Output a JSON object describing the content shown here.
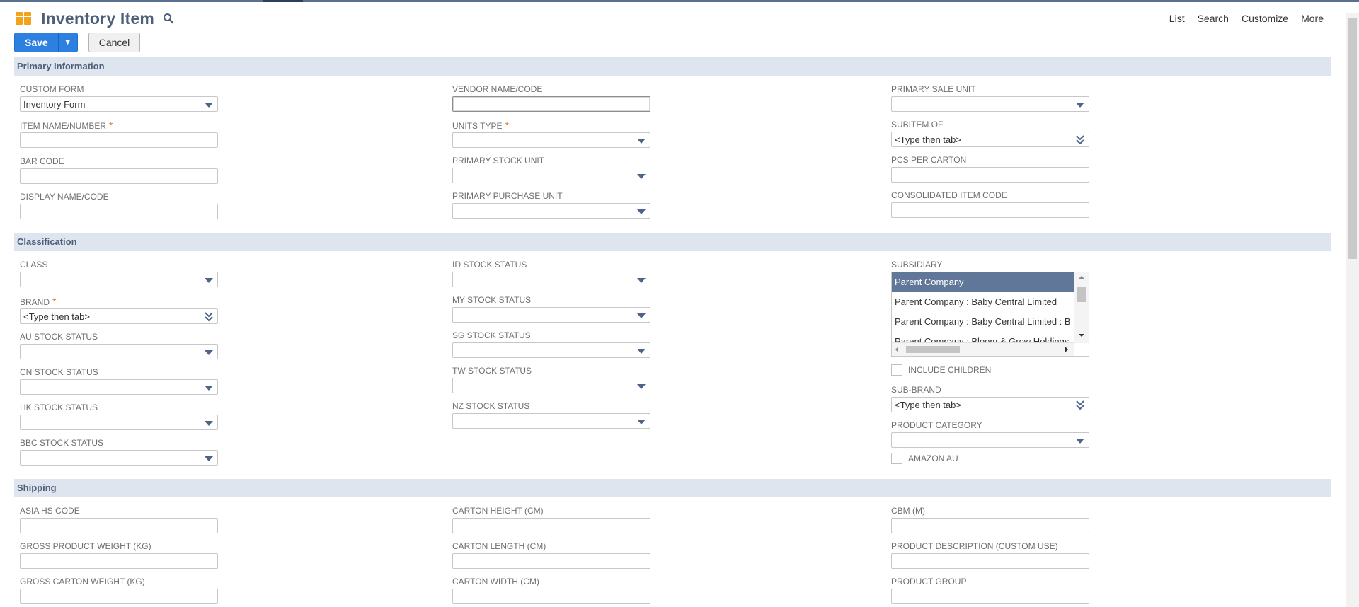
{
  "header": {
    "title": "Inventory Item",
    "links": [
      "List",
      "Search",
      "Customize",
      "More"
    ]
  },
  "buttons": {
    "save": "Save",
    "save_menu": "▼",
    "cancel": "Cancel"
  },
  "sections": {
    "primary": "Primary Information",
    "classification": "Classification",
    "shipping": "Shipping"
  },
  "primary": {
    "custom_form": {
      "label": "CUSTOM FORM",
      "value": "Inventory Form"
    },
    "item_name": {
      "label": "ITEM NAME/NUMBER",
      "value": "",
      "required": "*"
    },
    "bar_code": {
      "label": "BAR CODE",
      "value": ""
    },
    "display_name": {
      "label": "DISPLAY NAME/CODE",
      "value": ""
    },
    "vendor_name": {
      "label": "VENDOR NAME/CODE",
      "value": ""
    },
    "units_type": {
      "label": "UNITS TYPE",
      "value": "",
      "required": "*"
    },
    "primary_stock_unit": {
      "label": "PRIMARY STOCK UNIT",
      "value": ""
    },
    "primary_purchase_unit": {
      "label": "PRIMARY PURCHASE UNIT",
      "value": ""
    },
    "primary_sale_unit": {
      "label": "PRIMARY SALE UNIT",
      "value": ""
    },
    "subitem_of": {
      "label": "SUBITEM OF",
      "value": "<Type then tab>"
    },
    "pcs_per_carton": {
      "label": "PCS PER CARTON",
      "value": ""
    },
    "consolidated_item_code": {
      "label": "CONSOLIDATED ITEM CODE",
      "value": ""
    }
  },
  "classification": {
    "class": {
      "label": "CLASS",
      "value": ""
    },
    "brand": {
      "label": "BRAND",
      "value": "<Type then tab>",
      "required": "*"
    },
    "au_stock": {
      "label": "AU STOCK STATUS",
      "value": ""
    },
    "cn_stock": {
      "label": "CN STOCK STATUS",
      "value": ""
    },
    "hk_stock": {
      "label": "HK STOCK STATUS",
      "value": ""
    },
    "bbc_stock": {
      "label": "BBC STOCK STATUS",
      "value": ""
    },
    "id_stock": {
      "label": "ID STOCK STATUS",
      "value": ""
    },
    "my_stock": {
      "label": "MY STOCK STATUS",
      "value": ""
    },
    "sg_stock": {
      "label": "SG STOCK STATUS",
      "value": ""
    },
    "tw_stock": {
      "label": "TW STOCK STATUS",
      "value": ""
    },
    "nz_stock": {
      "label": "NZ STOCK STATUS",
      "value": ""
    },
    "subsidiary": {
      "label": "SUBSIDIARY",
      "options": [
        "Parent Company",
        "Parent Company : Baby Central Limited",
        "Parent Company : Baby Central Limited : B",
        "Parent Company : Bloom & Grow Holdings"
      ],
      "selected": "Parent Company"
    },
    "include_children": {
      "label": "INCLUDE CHILDREN",
      "checked": false
    },
    "sub_brand": {
      "label": "SUB-BRAND",
      "value": "<Type then tab>"
    },
    "product_category": {
      "label": "PRODUCT CATEGORY",
      "value": ""
    },
    "amazon_au": {
      "label": "AMAZON AU",
      "checked": false
    }
  },
  "shipping": {
    "asia_hs_code": {
      "label": "ASIA HS CODE",
      "value": ""
    },
    "gross_product_weight": {
      "label": "GROSS PRODUCT WEIGHT (KG)",
      "value": ""
    },
    "gross_carton_weight": {
      "label": "GROSS CARTON WEIGHT (KG)",
      "value": ""
    },
    "carton_height": {
      "label": "CARTON HEIGHT (CM)",
      "value": ""
    },
    "carton_length": {
      "label": "CARTON LENGTH (CM)",
      "value": ""
    },
    "carton_width": {
      "label": "CARTON WIDTH (CM)",
      "value": ""
    },
    "cbm": {
      "label": "CBM (M)",
      "value": ""
    },
    "product_description": {
      "label": "PRODUCT DESCRIPTION (CUSTOM USE)",
      "value": ""
    },
    "product_group": {
      "label": "PRODUCT GROUP",
      "value": ""
    }
  },
  "colors": {
    "accent": "#2d7fe0",
    "section_bg": "#dfe5ee",
    "title": "#4d5f79",
    "selected_option": "#607799",
    "required": "#e0812a"
  }
}
